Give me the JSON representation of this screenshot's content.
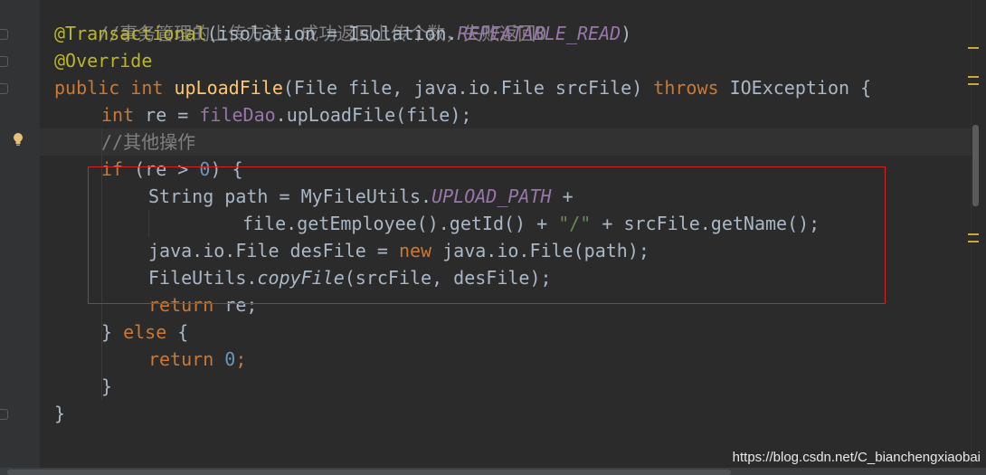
{
  "editor": {
    "line_comment_top": "//事务管理的上传方法，成功返回上传个数，失败返回0",
    "annotation_transactional": "@Transactional",
    "paren_open": "(",
    "isolation_param": "isolation = Isolation.",
    "repeatable_read": "REPEATABLE_READ",
    "paren_close": ")",
    "annotation_override": "@Override",
    "kw_public": "public",
    "kw_int": "int",
    "method_upload": "upLoadFile",
    "params": "(File file, java.io.File srcFile) ",
    "kw_throws": "throws",
    "exception_tail": " IOException {",
    "var_re_decl": " re = ",
    "field_fileDao": "fileDao",
    "call_upload": ".upLoadFile(file);",
    "comment_other": "//其他操作",
    "kw_if": "if",
    "if_cond_open": " (re > ",
    "num_zero": "0",
    "if_cond_close": ") {",
    "path_decl": "String path = MyFileUtils.",
    "upload_path": "UPLOAD_PATH",
    "plus": " +",
    "path_cont_a": "file.getEmployee().getId() + ",
    "str_slash": "\"/\"",
    "path_cont_b": " + srcFile.getName();",
    "desfile_decl": "java.io.File desFile = ",
    "kw_new": "new",
    "desfile_ctor": " java.io.File(path);",
    "fileutils": "FileUtils.",
    "copyfile": "copyFile",
    "copy_args": "(srcFile, desFile);",
    "kw_return": "return",
    "return_re": " re;",
    "brace_close_else": "} ",
    "kw_else": "else",
    "else_open": " {",
    "return_zero_semi": ";",
    "brace_close": "}"
  },
  "watermark": "https://blog.csdn.net/C_bianchengxiaobai",
  "colors": {
    "background": "#2b2b2b",
    "keyword": "#cc7832",
    "annotation": "#bbb529",
    "method": "#ffc66d",
    "field": "#9876aa",
    "number": "#6897bb",
    "string": "#6a8759",
    "comment": "#808080",
    "text": "#a9b7c6",
    "highlight_box": "#d32323"
  },
  "icons": [
    "lightbulb-icon",
    "fold-marker-icon"
  ]
}
